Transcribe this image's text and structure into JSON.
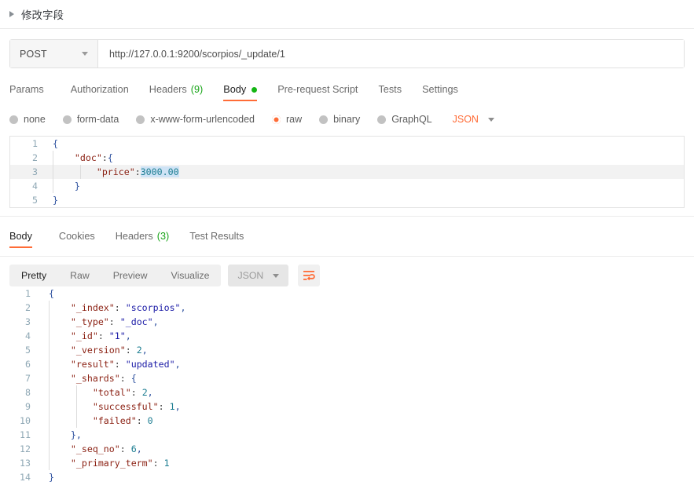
{
  "folder": {
    "title": "修改字段",
    "caret_icon": "caret-right-icon"
  },
  "request": {
    "method": "POST",
    "method_chevron_icon": "chevron-down-icon",
    "url": "http://127.0.0.1:9200/scorpios/_update/1",
    "tabs": [
      {
        "label": "Params",
        "count": "",
        "active": false,
        "dot": false
      },
      {
        "label": "Authorization",
        "count": "",
        "active": false,
        "dot": false
      },
      {
        "label": "Headers",
        "count": "(9)",
        "active": false,
        "dot": false
      },
      {
        "label": "Body",
        "count": "",
        "active": true,
        "dot": true
      },
      {
        "label": "Pre-request Script",
        "count": "",
        "active": false,
        "dot": false
      },
      {
        "label": "Tests",
        "count": "",
        "active": false,
        "dot": false
      },
      {
        "label": "Settings",
        "count": "",
        "active": false,
        "dot": false
      }
    ],
    "body_types": [
      {
        "label": "none",
        "selected": false
      },
      {
        "label": "form-data",
        "selected": false
      },
      {
        "label": "x-www-form-urlencoded",
        "selected": false
      },
      {
        "label": "raw",
        "selected": true
      },
      {
        "label": "binary",
        "selected": false
      },
      {
        "label": "GraphQL",
        "selected": false
      }
    ],
    "format_label": "JSON",
    "format_chevron_icon": "chevron-down-icon",
    "body_lines": [
      {
        "num": "1",
        "text": "{"
      },
      {
        "num": "2",
        "text": "    \"doc\":{"
      },
      {
        "num": "3",
        "text": "        \"price\":3000.00"
      },
      {
        "num": "4",
        "text": "    }"
      },
      {
        "num": "5",
        "text": "}"
      }
    ]
  },
  "response": {
    "tabs": [
      {
        "label": "Body",
        "count": "",
        "active": true
      },
      {
        "label": "Cookies",
        "count": "",
        "active": false
      },
      {
        "label": "Headers",
        "count": "(3)",
        "active": false
      },
      {
        "label": "Test Results",
        "count": "",
        "active": false
      }
    ],
    "format_buttons": [
      {
        "label": "Pretty",
        "active": true
      },
      {
        "label": "Raw",
        "active": false
      },
      {
        "label": "Preview",
        "active": false
      },
      {
        "label": "Visualize",
        "active": false
      }
    ],
    "format_label": "JSON",
    "format_chevron_icon": "chevron-down-icon",
    "wrap_icon": "word-wrap-icon",
    "body_lines": [
      {
        "num": "1",
        "text": "{"
      },
      {
        "num": "2",
        "text": "    \"_index\": \"scorpios\","
      },
      {
        "num": "3",
        "text": "    \"_type\": \"_doc\","
      },
      {
        "num": "4",
        "text": "    \"_id\": \"1\","
      },
      {
        "num": "5",
        "text": "    \"_version\": 2,"
      },
      {
        "num": "6",
        "text": "    \"result\": \"updated\","
      },
      {
        "num": "7",
        "text": "    \"_shards\": {"
      },
      {
        "num": "8",
        "text": "        \"total\": 2,"
      },
      {
        "num": "9",
        "text": "        \"successful\": 1,"
      },
      {
        "num": "10",
        "text": "        \"failed\": 0"
      },
      {
        "num": "11",
        "text": "    },"
      },
      {
        "num": "12",
        "text": "    \"_seq_no\": 6,"
      },
      {
        "num": "13",
        "text": "    \"_primary_term\": 1"
      },
      {
        "num": "14",
        "text": "}"
      }
    ]
  },
  "colors": {
    "accent": "#ff6c37",
    "count_green": "#1aa51a",
    "dot_green": "#14b514",
    "json_key": "#8a1f11",
    "json_string": "#1a1aa6",
    "json_number": "#1c7d91"
  }
}
